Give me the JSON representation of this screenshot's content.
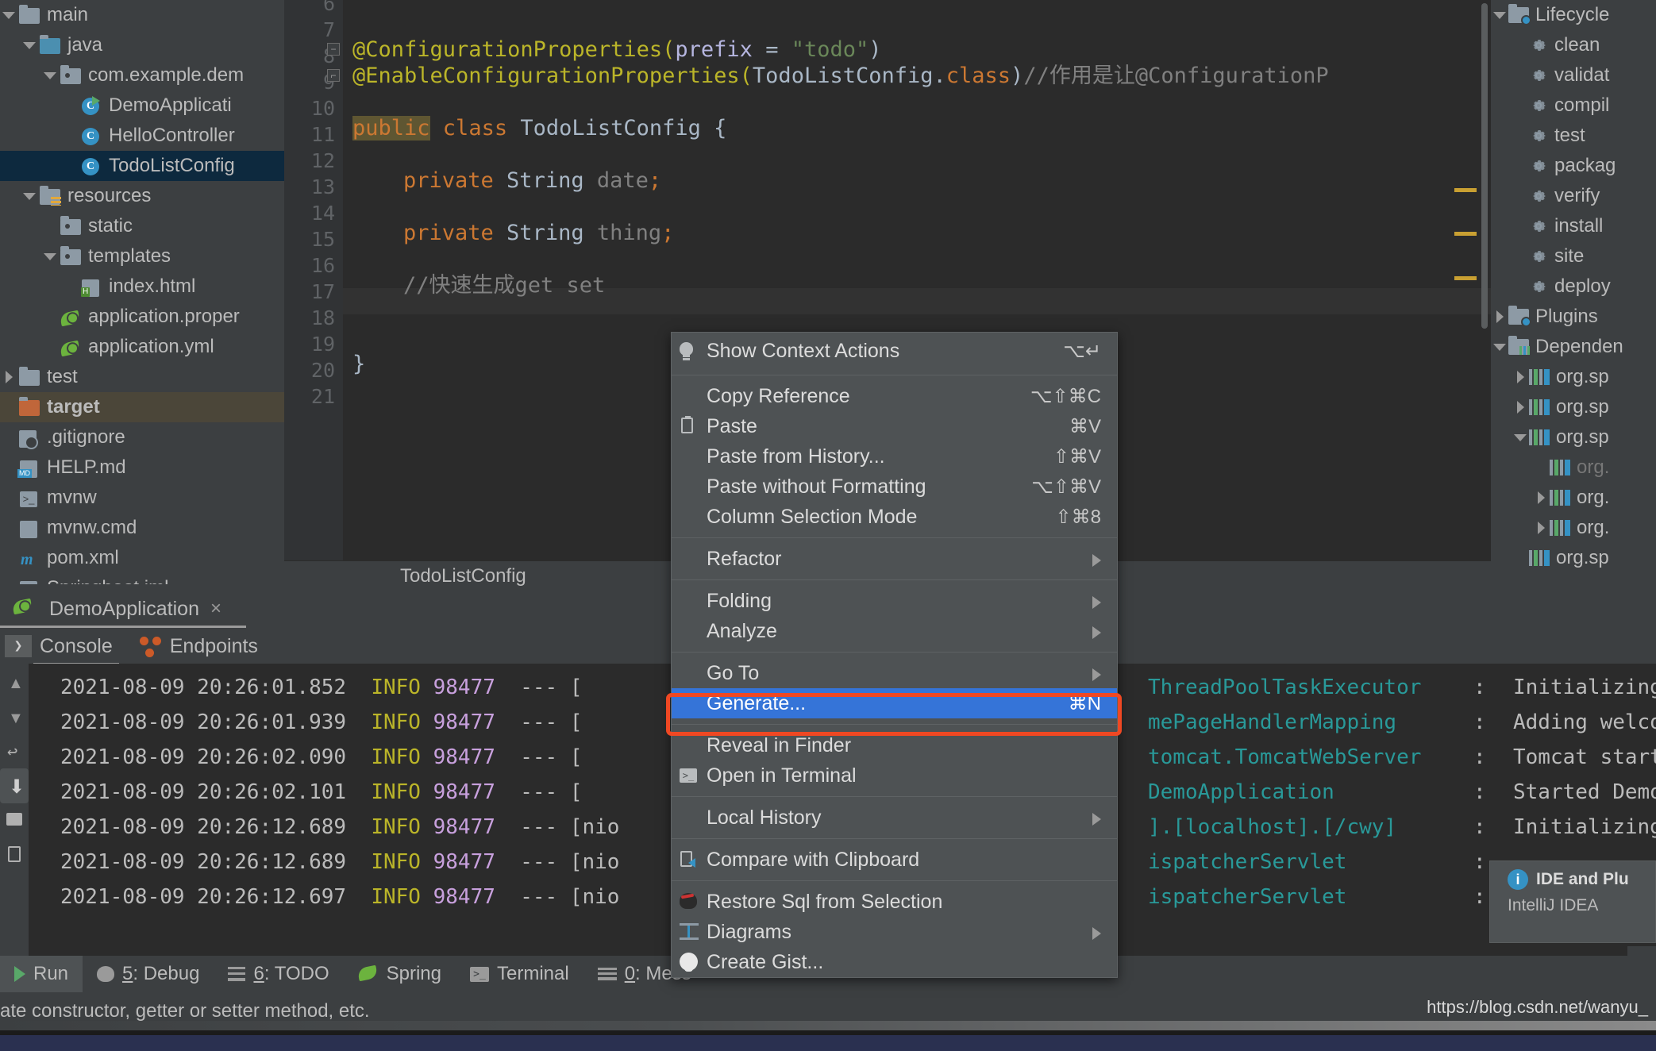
{
  "project_tree": [
    {
      "label": "main",
      "indent": 0,
      "arrow": "down",
      "icon": "folder",
      "state": "normal"
    },
    {
      "label": "java",
      "indent": 1,
      "arrow": "down",
      "icon": "folder-blue",
      "state": "normal"
    },
    {
      "label": "com.example.dem",
      "indent": 2,
      "arrow": "down",
      "icon": "package",
      "state": "normal"
    },
    {
      "label": "DemoApplicati",
      "indent": 3,
      "arrow": "none",
      "icon": "class-run",
      "state": "normal"
    },
    {
      "label": "HelloController",
      "indent": 3,
      "arrow": "none",
      "icon": "class",
      "state": "normal"
    },
    {
      "label": "TodoListConfig",
      "indent": 3,
      "arrow": "none",
      "icon": "class",
      "state": "selected"
    },
    {
      "label": "resources",
      "indent": 1,
      "arrow": "down",
      "icon": "folder-res",
      "state": "normal"
    },
    {
      "label": "static",
      "indent": 2,
      "arrow": "none",
      "icon": "package",
      "state": "normal"
    },
    {
      "label": "templates",
      "indent": 2,
      "arrow": "down",
      "icon": "package",
      "state": "normal"
    },
    {
      "label": "index.html",
      "indent": 3,
      "arrow": "none",
      "icon": "html",
      "state": "normal"
    },
    {
      "label": "application.proper",
      "indent": 2,
      "arrow": "none",
      "icon": "spring",
      "state": "normal"
    },
    {
      "label": "application.yml",
      "indent": 2,
      "arrow": "none",
      "icon": "spring",
      "state": "normal"
    },
    {
      "label": "test",
      "indent": 0,
      "arrow": "right",
      "icon": "folder",
      "state": "normal"
    },
    {
      "label": "target",
      "indent": 0,
      "arrow": "none",
      "icon": "folder-orange",
      "state": "target"
    },
    {
      "label": ".gitignore",
      "indent": 0,
      "arrow": "none",
      "icon": "git",
      "state": "normal"
    },
    {
      "label": "HELP.md",
      "indent": 0,
      "arrow": "none",
      "icon": "md",
      "state": "normal"
    },
    {
      "label": "mvnw",
      "indent": 0,
      "arrow": "none",
      "icon": "terminal",
      "state": "normal"
    },
    {
      "label": "mvnw.cmd",
      "indent": 0,
      "arrow": "none",
      "icon": "file",
      "state": "normal"
    },
    {
      "label": "pom.xml",
      "indent": 0,
      "arrow": "none",
      "icon": "maven",
      "state": "normal"
    },
    {
      "label": "Springboot.iml",
      "indent": 0,
      "arrow": "none",
      "icon": "file",
      "state": "normal"
    }
  ],
  "editor": {
    "breadcrumb": "TodoListConfig",
    "line_numbers": [
      "6",
      "7",
      "8",
      "9",
      "10",
      "11",
      "12",
      "13",
      "14",
      "15",
      "16",
      "17",
      "18",
      "19",
      "20",
      "21"
    ],
    "code_lines": {
      "l8_a": "@ConfigurationProperties(",
      "l8_param": "prefix",
      "l8_eq": " = ",
      "l8_str": "\"todo\"",
      "l8_close": ")",
      "l9_a": "@EnableConfigurationProperties(",
      "l9_type": "TodoListConfig.",
      "l9_class": "class",
      "l9_close": ")",
      "l9_comment": "//作用是让@ConfigurationP",
      "l11_public": "public",
      "l11_class": " class ",
      "l11_name": "TodoListConfig {",
      "l13_priv": "private",
      "l13_type": " String ",
      "l13_name": "date",
      "l13_semi": ";",
      "l15_priv": "private",
      "l15_type": " String ",
      "l15_name": "thing",
      "l15_semi": ";",
      "l17_comment": "//快速生成get set",
      "l20_brace": "}"
    }
  },
  "maven_panel": [
    {
      "label": "Lifecycle",
      "indent": 0,
      "arrow": "down",
      "icon": "folder-cog"
    },
    {
      "label": "clean",
      "indent": 1,
      "arrow": "none",
      "icon": "gear"
    },
    {
      "label": "validat",
      "indent": 1,
      "arrow": "none",
      "icon": "gear"
    },
    {
      "label": "compil",
      "indent": 1,
      "arrow": "none",
      "icon": "gear"
    },
    {
      "label": "test",
      "indent": 1,
      "arrow": "none",
      "icon": "gear"
    },
    {
      "label": "packag",
      "indent": 1,
      "arrow": "none",
      "icon": "gear"
    },
    {
      "label": "verify",
      "indent": 1,
      "arrow": "none",
      "icon": "gear"
    },
    {
      "label": "install",
      "indent": 1,
      "arrow": "none",
      "icon": "gear"
    },
    {
      "label": "site",
      "indent": 1,
      "arrow": "none",
      "icon": "gear"
    },
    {
      "label": "deploy",
      "indent": 1,
      "arrow": "none",
      "icon": "gear"
    },
    {
      "label": "Plugins",
      "indent": 0,
      "arrow": "right",
      "icon": "folder-cog"
    },
    {
      "label": "Dependen",
      "indent": 0,
      "arrow": "down",
      "icon": "folder-dep"
    },
    {
      "label": "org.sp",
      "indent": 1,
      "arrow": "right",
      "icon": "dep"
    },
    {
      "label": "org.sp",
      "indent": 1,
      "arrow": "right",
      "icon": "dep"
    },
    {
      "label": "org.sp",
      "indent": 1,
      "arrow": "down",
      "icon": "dep"
    },
    {
      "label": "org.",
      "indent": 2,
      "arrow": "none",
      "icon": "dep",
      "dim": true
    },
    {
      "label": "org.",
      "indent": 2,
      "arrow": "right",
      "icon": "dep"
    },
    {
      "label": "org.",
      "indent": 2,
      "arrow": "right",
      "icon": "dep"
    },
    {
      "label": "org.sp",
      "indent": 1,
      "arrow": "none",
      "icon": "dep"
    }
  ],
  "run_panel": {
    "tab_title": "DemoApplication",
    "close_label": "×",
    "console_tab": "Console",
    "endpoints_tab": "Endpoints"
  },
  "console_lines": [
    {
      "date": "2021-08-09 20:26:01.852",
      "level": "INFO",
      "pid": "98477",
      "dash": "---",
      "thread": "[",
      "cls": "ThreadPoolTaskExecutor",
      "sep": ":",
      "msg": "Initializing"
    },
    {
      "date": "2021-08-09 20:26:01.939",
      "level": "INFO",
      "pid": "98477",
      "dash": "---",
      "thread": "[",
      "cls": "mePageHandlerMapping",
      "sep": ":",
      "msg": "Adding welco"
    },
    {
      "date": "2021-08-09 20:26:02.090",
      "level": "INFO",
      "pid": "98477",
      "dash": "---",
      "thread": "[",
      "cls": "tomcat.TomcatWebServer",
      "sep": ":",
      "msg": "Tomcat start"
    },
    {
      "date": "2021-08-09 20:26:02.101",
      "level": "INFO",
      "pid": "98477",
      "dash": "---",
      "thread": "[",
      "cls": "DemoApplication",
      "sep": ":",
      "msg": "Started Demo"
    },
    {
      "date": "2021-08-09 20:26:12.689",
      "level": "INFO",
      "pid": "98477",
      "dash": "---",
      "thread": "[nio",
      "cls": "].[localhost].[/cwy]",
      "sep": ":",
      "msg": "Initializing"
    },
    {
      "date": "2021-08-09 20:26:12.689",
      "level": "INFO",
      "pid": "98477",
      "dash": "---",
      "thread": "[nio",
      "cls": "ispatcherServlet",
      "sep": ":",
      "msg": ""
    },
    {
      "date": "2021-08-09 20:26:12.697",
      "level": "INFO",
      "pid": "98477",
      "dash": "---",
      "thread": "[nio",
      "cls": "ispatcherServlet",
      "sep": ":",
      "msg": ""
    }
  ],
  "context_menu": {
    "items": [
      {
        "label": "Show Context Actions",
        "shortcut": "⌥↵",
        "icon": "lightbulb-icon",
        "submenu": false,
        "highlighted": false
      },
      {
        "sep": true
      },
      {
        "label": "Copy Reference",
        "shortcut": "⌥⇧⌘C",
        "icon": "",
        "submenu": false,
        "highlighted": false
      },
      {
        "label": "Paste",
        "shortcut": "⌘V",
        "icon": "clipboard-icon",
        "submenu": false,
        "highlighted": false
      },
      {
        "label": "Paste from History...",
        "shortcut": "⇧⌘V",
        "icon": "",
        "submenu": false,
        "highlighted": false
      },
      {
        "label": "Paste without Formatting",
        "shortcut": "⌥⇧⌘V",
        "icon": "",
        "submenu": false,
        "highlighted": false
      },
      {
        "label": "Column Selection Mode",
        "shortcut": "⇧⌘8",
        "icon": "",
        "submenu": false,
        "highlighted": false
      },
      {
        "sep": true
      },
      {
        "label": "Refactor",
        "shortcut": "",
        "icon": "",
        "submenu": true,
        "highlighted": false
      },
      {
        "sep": true
      },
      {
        "label": "Folding",
        "shortcut": "",
        "icon": "",
        "submenu": true,
        "highlighted": false
      },
      {
        "label": "Analyze",
        "shortcut": "",
        "icon": "",
        "submenu": true,
        "highlighted": false
      },
      {
        "sep": true
      },
      {
        "label": "Go To",
        "shortcut": "",
        "icon": "",
        "submenu": true,
        "highlighted": false
      },
      {
        "label": "Generate...",
        "shortcut": "⌘N",
        "icon": "",
        "submenu": false,
        "highlighted": true
      },
      {
        "sep": true
      },
      {
        "label": "Reveal in Finder",
        "shortcut": "",
        "icon": "",
        "submenu": false,
        "highlighted": false
      },
      {
        "label": "Open in Terminal",
        "shortcut": "",
        "icon": "terminal-icon",
        "submenu": false,
        "highlighted": false
      },
      {
        "sep": true
      },
      {
        "label": "Local History",
        "shortcut": "",
        "icon": "",
        "submenu": true,
        "highlighted": false
      },
      {
        "sep": true
      },
      {
        "label": "Compare with Clipboard",
        "shortcut": "",
        "icon": "compare-clipboard-icon",
        "submenu": false,
        "highlighted": false
      },
      {
        "sep": true
      },
      {
        "label": "Restore Sql from Selection",
        "shortcut": "",
        "icon": "sql-icon",
        "submenu": false,
        "highlighted": false
      },
      {
        "label": "Diagrams",
        "shortcut": "",
        "icon": "diagram-icon",
        "submenu": true,
        "highlighted": false
      },
      {
        "label": "Create Gist...",
        "shortcut": "",
        "icon": "github-icon",
        "submenu": false,
        "highlighted": false
      }
    ]
  },
  "balloon": {
    "title": "IDE and Plu",
    "body": "IntelliJ IDEA"
  },
  "bottom_toolbar": [
    {
      "label": "Run",
      "num": "",
      "icon": "run-icon",
      "active": true
    },
    {
      "label": ": Debug",
      "num": "5",
      "icon": "bug-icon",
      "active": false
    },
    {
      "label": ": TODO",
      "num": "6",
      "icon": "list-icon",
      "active": false
    },
    {
      "label": "Spring",
      "num": "",
      "icon": "spring-icon",
      "active": false
    },
    {
      "label": "Terminal",
      "num": "",
      "icon": "terminal-icon",
      "active": false
    },
    {
      "label": ": Mess",
      "num": "0",
      "icon": "messages-icon",
      "active": false
    }
  ],
  "hint_bar": {
    "text": "ate constructor, getter or setter method, etc."
  },
  "watermark": {
    "text": "https://blog.csdn.net/wanyu_"
  },
  "colors": {
    "panel_bg": "#3c3f41",
    "editor_bg": "#2b2b2b",
    "selection_blue": "#3574d8",
    "highlight_ring": "#ef4823",
    "annotation_yellow": "#bbb529",
    "keyword_orange": "#cc7832",
    "string_green": "#6a8759",
    "log_class_teal": "#299999",
    "log_pid_purple": "#c8a0dd"
  }
}
